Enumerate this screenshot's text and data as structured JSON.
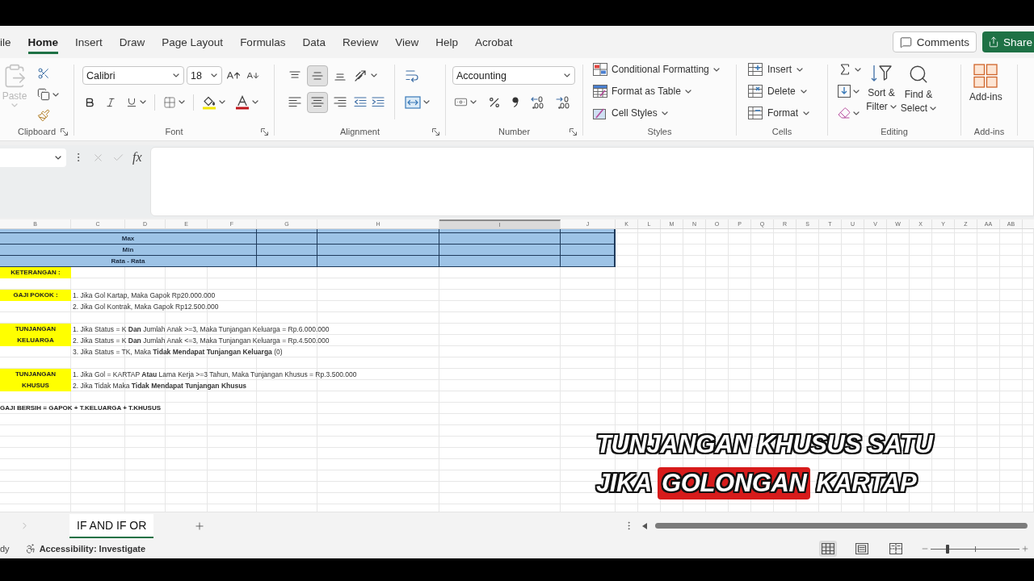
{
  "menu": {
    "tabs": [
      {
        "label": "ile",
        "selected": false
      },
      {
        "label": "Home",
        "selected": true
      },
      {
        "label": "Insert",
        "selected": false
      },
      {
        "label": "Draw",
        "selected": false
      },
      {
        "label": "Page Layout",
        "selected": false
      },
      {
        "label": "Formulas",
        "selected": false
      },
      {
        "label": "Data",
        "selected": false
      },
      {
        "label": "Review",
        "selected": false
      },
      {
        "label": "View",
        "selected": false
      },
      {
        "label": "Help",
        "selected": false
      },
      {
        "label": "Acrobat",
        "selected": false
      }
    ],
    "comments": "Comments",
    "share": "Share"
  },
  "ribbon": {
    "clipboard": {
      "title": "Clipboard",
      "paste": {
        "label": "Paste",
        "disabled": true
      }
    },
    "font": {
      "title": "Font",
      "name": "Calibri",
      "size": "18"
    },
    "alignment": {
      "title": "Alignment",
      "vertical": [
        {
          "selected": false
        },
        {
          "selected": true
        },
        {
          "selected": false
        }
      ],
      "horizontal": [
        {
          "selected": false
        },
        {
          "selected": true
        },
        {
          "selected": false
        }
      ]
    },
    "number": {
      "title": "Number",
      "format": "Accounting"
    },
    "styles": {
      "title": "Styles",
      "items": [
        "Conditional Formatting",
        "Format as Table",
        "Cell Styles"
      ]
    },
    "cells": {
      "title": "Cells",
      "items": [
        "Insert",
        "Delete",
        "Format"
      ]
    },
    "editing": {
      "title": "Editing",
      "items": [
        "Sort & Filter",
        "Find & Select"
      ]
    },
    "addins": {
      "title": "Add-ins",
      "label": "Add-ins"
    }
  },
  "formula_bar": {
    "function_label": "fx"
  },
  "columns": [
    {
      "label": "B",
      "selected": false
    },
    {
      "label": "C",
      "selected": false
    },
    {
      "label": "D",
      "selected": false
    },
    {
      "label": "E",
      "selected": false
    },
    {
      "label": "F",
      "selected": false
    },
    {
      "label": "G",
      "selected": false
    },
    {
      "label": "H",
      "selected": false
    },
    {
      "label": "I",
      "selected": true
    },
    {
      "label": "J",
      "selected": false
    },
    {
      "label": "K",
      "selected": false
    },
    {
      "label": "L",
      "selected": false
    },
    {
      "label": "M",
      "selected": false
    },
    {
      "label": "N",
      "selected": false
    },
    {
      "label": "O",
      "selected": false
    },
    {
      "label": "P",
      "selected": false
    },
    {
      "label": "Q",
      "selected": false
    },
    {
      "label": "R",
      "selected": false
    },
    {
      "label": "S",
      "selected": false
    },
    {
      "label": "T",
      "selected": false
    },
    {
      "label": "U",
      "selected": false
    },
    {
      "label": "V",
      "selected": false
    },
    {
      "label": "W",
      "selected": false
    },
    {
      "label": "X",
      "selected": false
    },
    {
      "label": "Y",
      "selected": false
    },
    {
      "label": "Z",
      "selected": false
    },
    {
      "label": "AA",
      "selected": false
    },
    {
      "label": "AB",
      "selected": false
    }
  ],
  "summary_rows": [
    "Max",
    "Min",
    "Rata - Rata"
  ],
  "notes": {
    "heading": "KETERANGAN :",
    "groups": [
      {
        "label": "GAJI POKOK :",
        "lines": [
          "1. Jika Gol Kartap, Maka Gapok Rp20.000.000",
          "2. Jika Gol Kontrak, Maka Gapok Rp12.500.000"
        ]
      },
      {
        "label": "TUNJANGAN KELUARGA",
        "lines": [
          "1. Jika Status = K **Dan** Jumlah Anak >=3, Maka Tunjangan Keluarga = Rp.6.000.000",
          "2. Jika Status = K **Dan** Jumlah Anak <=3, Maka Tunjangan Keluarga = Rp.4.500.000",
          "3. Jika Status = TK, Maka **Tidak Mendapat Tunjangan Keluarga** (0)"
        ]
      },
      {
        "label": "TUNJANGAN KHUSUS",
        "lines": [
          "1. Jika Gol = KARTAP **Atau** Lama Kerja >=3 Tahun, Maka Tunjangan Khusus = Rp.3.500.000",
          "2. Jika Tidak Maka **Tidak Mendapat Tunjangan Khusus**"
        ]
      }
    ],
    "formula": "GAJI BERSIH = GAPOK + T.KELUARGA + T.KHUSUS"
  },
  "sheet_tabs": [
    {
      "label": "IF AND IF OR",
      "selected": true
    }
  ],
  "status_bar": {
    "mode": "dy",
    "accessibility": "Accessibility: Investigate",
    "views": [
      {
        "selected": true
      },
      {
        "selected": false
      },
      {
        "selected": false
      }
    ],
    "zoom": {
      "level": 0.19
    }
  },
  "caption": {
    "lines": [
      [
        {
          "text": "TUNJANGAN KHUSUS SATU",
          "highlight": false
        }
      ],
      [
        {
          "text": "JIKA",
          "highlight": false
        },
        {
          "text": "GOLONGAN",
          "highlight": true
        },
        {
          "text": "KARTAP",
          "highlight": false
        }
      ]
    ]
  }
}
